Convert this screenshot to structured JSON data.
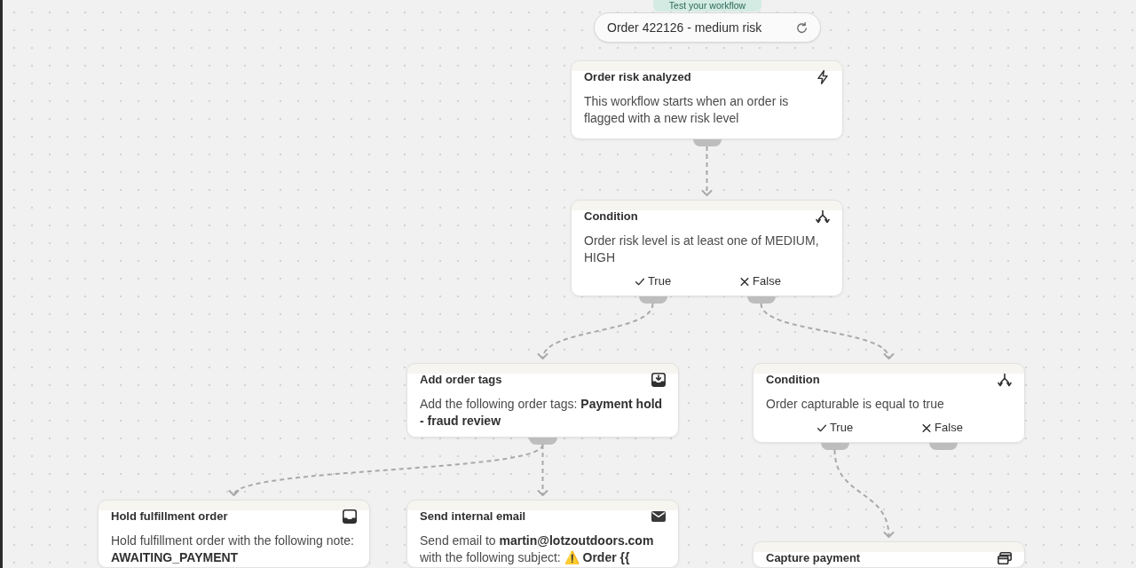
{
  "test_panel": {
    "label": "Test your workflow",
    "order_selector": "Order 422126 - medium risk"
  },
  "workflow": {
    "kind": "trigger",
    "title": "Order risk analyzed",
    "description": "This workflow starts when an order is flagged with a new risk level",
    "children": [
      {
        "kind": "condition",
        "title": "Condition",
        "description": "Order risk level is at least one of MEDIUM, HIGH",
        "branches": [
          {
            "kind": "true",
            "label": "True",
            "children": [
              {
                "kind": "add_tags",
                "title": "Add order tags",
                "description": "Add the following order tags: **Payment hold - fraud review**",
                "children": [
                  {
                    "kind": "hold",
                    "title": "Hold fulfillment order",
                    "description": "Hold fulfillment order with the following note: **AWAITING_PAYMENT**"
                  },
                  {
                    "kind": "email",
                    "title": "Send internal email",
                    "description": "Send email to **martin@lotzoutdoors.com** with the following subject: ⚠️ **Order {{**"
                  }
                ]
              }
            ]
          },
          {
            "kind": "false",
            "label": "False",
            "children": [
              {
                "kind": "condition",
                "title": "Condition",
                "description": "Order capturable is equal to true",
                "branches": [
                  {
                    "kind": "true",
                    "label": "True",
                    "children": [
                      {
                        "kind": "capture_payment",
                        "title": "Capture payment"
                      }
                    ]
                  },
                  {
                    "kind": "false",
                    "label": "False"
                  }
                ]
              }
            ]
          }
        ]
      }
    ]
  }
}
